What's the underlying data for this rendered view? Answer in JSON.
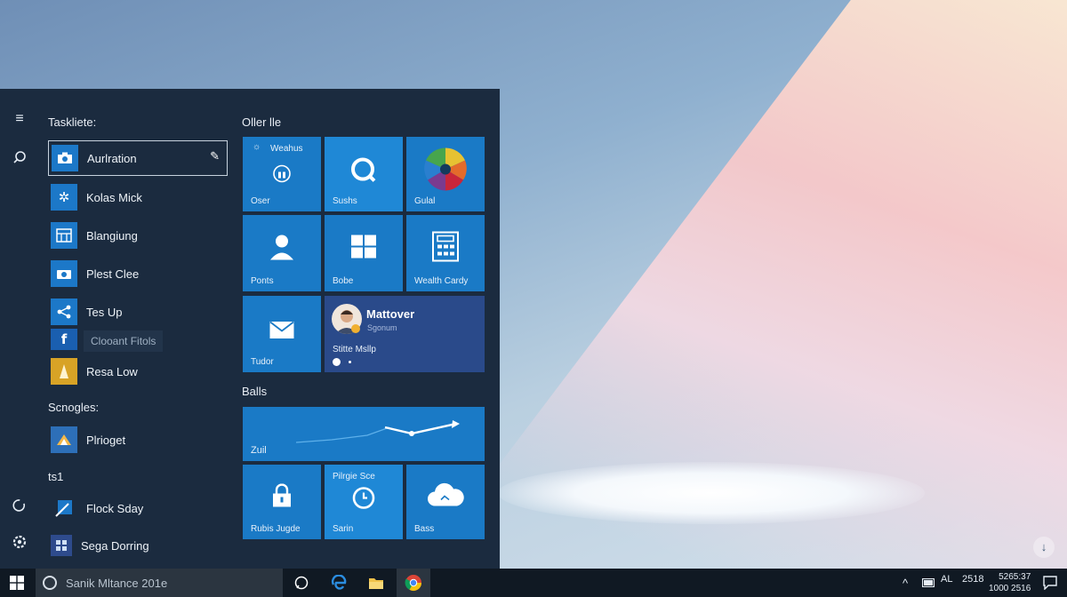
{
  "start_menu": {
    "group_recent": "Taskliete:",
    "apps_recent": [
      {
        "label": "Aurlration",
        "icon": "camera-app-icon"
      },
      {
        "label": "Kolas Mick",
        "icon": "gear-tile-icon"
      },
      {
        "label": "Blangiung",
        "icon": "calculator-icon"
      },
      {
        "label": "Plest Clee",
        "icon": "camera-icon"
      },
      {
        "label": "Tes Up",
        "icon": "share-icon"
      },
      {
        "label": "Resa Low",
        "icon": "document-icon"
      }
    ],
    "tooltip": "Clooant Fitols",
    "group_s": "Scnogles:",
    "apps_s": [
      {
        "label": "Plrioget",
        "icon": "paint-icon"
      }
    ],
    "group_t": "ts1",
    "apps_t": [
      {
        "label": "Flock Sday",
        "icon": "photo-icon"
      },
      {
        "label": "Sega Dorring",
        "icon": "grid-app-icon"
      }
    ]
  },
  "tiles": {
    "group1": "Oller lle",
    "weather_title": "Weahus",
    "tile_labels": {
      "oser": "Oser",
      "sushs": "Sushs",
      "gulal": "Gulal",
      "ponts": "Ponts",
      "bobe": "Bobe",
      "wealth": "Wealth Cardy",
      "tudor": "Tudor"
    },
    "people": {
      "title": "Mattover",
      "subtitle": "Sgonum",
      "line": "Stitte Msllp"
    },
    "group2": "Balls",
    "chart_label": "Zuil",
    "bottom": {
      "lock": "Rubis Jugde",
      "clock_title": "Pilrgie Sce",
      "clock_label": "Sarin",
      "cloud": "Bass"
    }
  },
  "taskbar": {
    "search_placeholder": "Sanik Mltance 201e",
    "tray_lang": "AL",
    "tray_num": "2518",
    "clock_line1": "5265:37",
    "clock_line2": "1000 2516"
  },
  "colors": {
    "tile_blue": "#1a7ac6",
    "tile_navy": "#2a4a8a",
    "start_bg": "#1b2b3f",
    "taskbar_bg": "#101923"
  }
}
